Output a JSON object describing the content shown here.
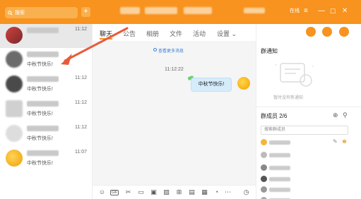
{
  "titlebar": {
    "search_placeholder": "搜索",
    "plus": "+",
    "status_label": "在线",
    "menu": "≡",
    "min": "—",
    "max": "☐",
    "close": "✕",
    "accent": "#f7931e"
  },
  "conversations": [
    {
      "time": "11:12",
      "message": "中秋节快乐!",
      "avatar_color": "#b23a3a",
      "active": true
    },
    {
      "time": "",
      "message": "中秋节快乐!",
      "avatar_color": "#6b6b6b"
    },
    {
      "time": "11:12",
      "message": "中秋节快乐!",
      "avatar_color": "#555555"
    },
    {
      "time": "11:12",
      "message": "中秋节快乐!",
      "avatar_color": "#cccccc"
    },
    {
      "time": "11:12",
      "message": "中秋节快乐!",
      "avatar_color": "#dddddd"
    },
    {
      "time": "11:07",
      "message": "中秋节快乐!",
      "avatar_color": "#f4b53a"
    }
  ],
  "tabs": [
    "聊天",
    "公告",
    "相册",
    "文件",
    "活动",
    "设置 ⌄"
  ],
  "chat": {
    "view_more": "查看更多消息",
    "timestamp": "11:12:22",
    "message": "中秋节快乐!"
  },
  "toolbar_icons": [
    "smile-icon",
    "gif-icon",
    "scissors-icon",
    "folder-icon",
    "image-icon",
    "picture-icon",
    "gift-icon",
    "video-icon",
    "calendar-icon",
    "bell-icon",
    "more-icon",
    "clock-icon"
  ],
  "toolbar_glyphs": {
    "gif": "GIF"
  },
  "right": {
    "notice_title": "群通知",
    "notice_empty": "暂时没有新通知",
    "members_title": "群成员 2/6",
    "members_search": "搜索群成员"
  },
  "member_colors": [
    "#f4b53a",
    "#bbbbbb",
    "#888888",
    "#555555",
    "#999999",
    "#aaaaaa"
  ]
}
